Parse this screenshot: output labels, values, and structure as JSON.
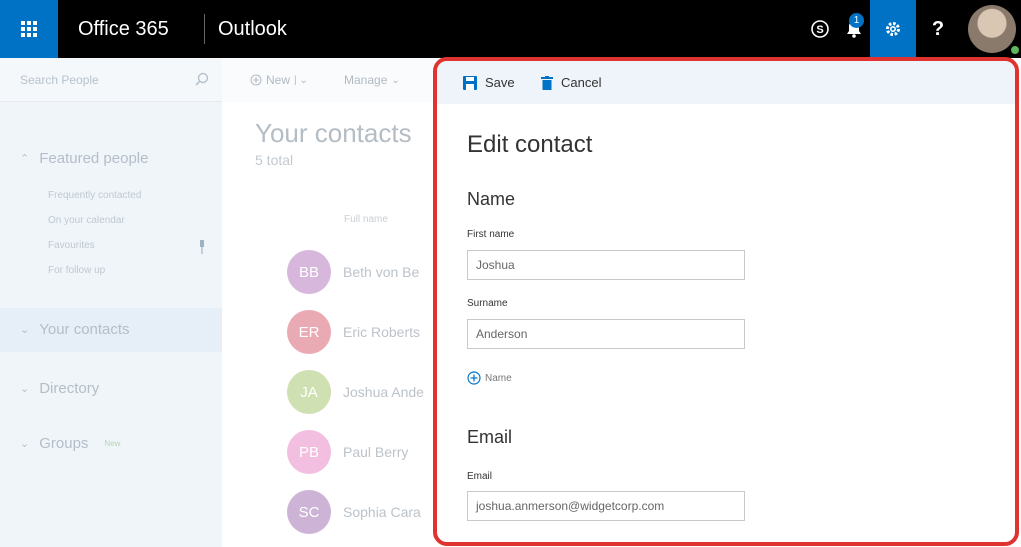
{
  "topbar": {
    "suite": "Office 365",
    "app": "Outlook",
    "notification_count": "1",
    "help": "?",
    "skype_icon": "skype-icon",
    "bell_icon": "bell-icon",
    "gear_icon": "gear-icon"
  },
  "colors": {
    "brand_blue": "#0072c6",
    "highlight_border": "#e0322f",
    "presence": "#5cb85c"
  },
  "leftnav": {
    "search_placeholder": "Search People",
    "sections": [
      {
        "label": "Featured people",
        "expanded": true
      },
      {
        "label": "Your contacts",
        "expanded": false,
        "selected": true
      },
      {
        "label": "Directory",
        "expanded": false
      },
      {
        "label": "Groups",
        "expanded": false,
        "badge": "New"
      }
    ],
    "featured_items": [
      "Frequently contacted",
      "On your calendar",
      "Favourites",
      "For follow up"
    ]
  },
  "toolbar": {
    "new_label": "New",
    "manage_label": "Manage"
  },
  "contacts": {
    "title": "Your contacts",
    "total": "5 total",
    "column_header": "Full name",
    "items": [
      {
        "initials": "BB",
        "name": "Beth von Be",
        "color": "#d8b7dc"
      },
      {
        "initials": "ER",
        "name": "Eric Roberts",
        "color": "#eaaab4"
      },
      {
        "initials": "JA",
        "name": "Joshua Ande",
        "color": "#cfe0b3"
      },
      {
        "initials": "PB",
        "name": "Paul Berry",
        "color": "#f2bfe0"
      },
      {
        "initials": "SC",
        "name": "Sophia Cara",
        "color": "#cdb4d6"
      }
    ]
  },
  "edit_panel": {
    "save_label": "Save",
    "cancel_label": "Cancel",
    "title": "Edit contact",
    "name_section": "Name",
    "first_name_label": "First name",
    "first_name_value": "Joshua",
    "surname_label": "Surname",
    "surname_value": "Anderson",
    "add_name_label": "Name",
    "email_section": "Email",
    "email_label": "Email",
    "email_value": "joshua.anmerson@widgetcorp.com"
  }
}
